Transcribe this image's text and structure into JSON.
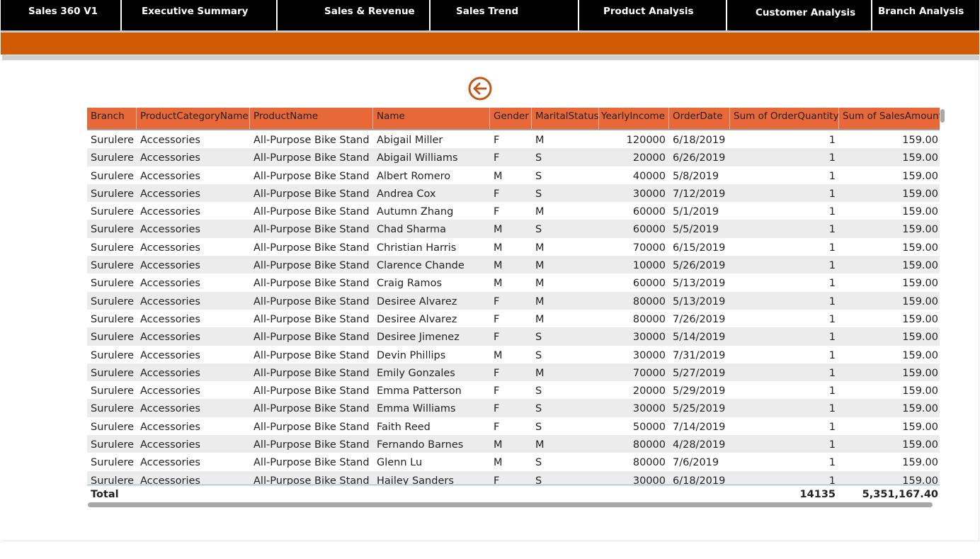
{
  "nav": {
    "items": [
      {
        "label": "Sales 360 V1"
      },
      {
        "label": "Executive Summary"
      },
      {
        "label": "Sales & Revenue"
      },
      {
        "label": "Sales Trend"
      },
      {
        "label": "Product Analysis"
      },
      {
        "label": "Customer Analysis"
      },
      {
        "label": "Branch Analysis"
      }
    ]
  },
  "colors": {
    "nav_bg": "#000000",
    "accent_band": "#d15b05",
    "table_header": "#e9683a",
    "back_icon": "#c0581c"
  },
  "back_button": {
    "icon": "arrow-left-circle-icon"
  },
  "table": {
    "columns": [
      "Branch",
      "ProductCategoryName",
      "ProductName",
      "Name",
      "Gender",
      "MaritalStatus",
      "YearlyIncome",
      "OrderDate",
      "Sum of OrderQuantity",
      "Sum of SalesAmount"
    ],
    "rows": [
      [
        "Surulere",
        "Accessories",
        "All-Purpose Bike Stand",
        "Abigail Miller",
        "F",
        "M",
        "120000",
        "6/18/2019",
        "1",
        "159.00"
      ],
      [
        "Surulere",
        "Accessories",
        "All-Purpose Bike Stand",
        "Abigail Williams",
        "F",
        "S",
        "20000",
        "6/26/2019",
        "1",
        "159.00"
      ],
      [
        "Surulere",
        "Accessories",
        "All-Purpose Bike Stand",
        "Albert Romero",
        "M",
        "S",
        "40000",
        "5/8/2019",
        "1",
        "159.00"
      ],
      [
        "Surulere",
        "Accessories",
        "All-Purpose Bike Stand",
        "Andrea Cox",
        "F",
        "S",
        "30000",
        "7/12/2019",
        "1",
        "159.00"
      ],
      [
        "Surulere",
        "Accessories",
        "All-Purpose Bike Stand",
        "Autumn Zhang",
        "F",
        "M",
        "60000",
        "5/1/2019",
        "1",
        "159.00"
      ],
      [
        "Surulere",
        "Accessories",
        "All-Purpose Bike Stand",
        "Chad Sharma",
        "M",
        "S",
        "60000",
        "5/5/2019",
        "1",
        "159.00"
      ],
      [
        "Surulere",
        "Accessories",
        "All-Purpose Bike Stand",
        "Christian Harris",
        "M",
        "M",
        "70000",
        "6/15/2019",
        "1",
        "159.00"
      ],
      [
        "Surulere",
        "Accessories",
        "All-Purpose Bike Stand",
        "Clarence Chande",
        "M",
        "M",
        "10000",
        "5/26/2019",
        "1",
        "159.00"
      ],
      [
        "Surulere",
        "Accessories",
        "All-Purpose Bike Stand",
        "Craig Ramos",
        "M",
        "M",
        "60000",
        "5/13/2019",
        "1",
        "159.00"
      ],
      [
        "Surulere",
        "Accessories",
        "All-Purpose Bike Stand",
        "Desiree Alvarez",
        "F",
        "M",
        "80000",
        "5/13/2019",
        "1",
        "159.00"
      ],
      [
        "Surulere",
        "Accessories",
        "All-Purpose Bike Stand",
        "Desiree Alvarez",
        "F",
        "M",
        "80000",
        "7/26/2019",
        "1",
        "159.00"
      ],
      [
        "Surulere",
        "Accessories",
        "All-Purpose Bike Stand",
        "Desiree Jimenez",
        "F",
        "S",
        "30000",
        "5/14/2019",
        "1",
        "159.00"
      ],
      [
        "Surulere",
        "Accessories",
        "All-Purpose Bike Stand",
        "Devin Phillips",
        "M",
        "S",
        "30000",
        "7/31/2019",
        "1",
        "159.00"
      ],
      [
        "Surulere",
        "Accessories",
        "All-Purpose Bike Stand",
        "Emily Gonzales",
        "F",
        "M",
        "70000",
        "5/27/2019",
        "1",
        "159.00"
      ],
      [
        "Surulere",
        "Accessories",
        "All-Purpose Bike Stand",
        "Emma Patterson",
        "F",
        "S",
        "20000",
        "5/29/2019",
        "1",
        "159.00"
      ],
      [
        "Surulere",
        "Accessories",
        "All-Purpose Bike Stand",
        "Emma Williams",
        "F",
        "S",
        "30000",
        "5/25/2019",
        "1",
        "159.00"
      ],
      [
        "Surulere",
        "Accessories",
        "All-Purpose Bike Stand",
        "Faith Reed",
        "F",
        "S",
        "50000",
        "7/14/2019",
        "1",
        "159.00"
      ],
      [
        "Surulere",
        "Accessories",
        "All-Purpose Bike Stand",
        "Fernando Barnes",
        "M",
        "M",
        "80000",
        "4/28/2019",
        "1",
        "159.00"
      ],
      [
        "Surulere",
        "Accessories",
        "All-Purpose Bike Stand",
        "Glenn Lu",
        "M",
        "S",
        "80000",
        "7/6/2019",
        "1",
        "159.00"
      ],
      [
        "Surulere",
        "Accessories",
        "All-Purpose Bike Stand",
        "Hailey Sanders",
        "F",
        "S",
        "30000",
        "6/18/2019",
        "1",
        "159.00"
      ]
    ],
    "total": {
      "label": "Total",
      "order_quantity": "14135",
      "sales_amount": "5,351,167.40"
    }
  }
}
